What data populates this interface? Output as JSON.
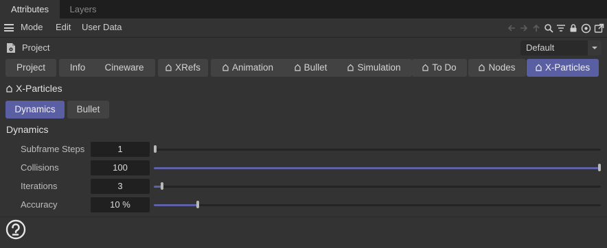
{
  "panel_tabs": {
    "attributes": "Attributes",
    "layers": "Layers"
  },
  "menu": {
    "mode": "Mode",
    "edit": "Edit",
    "user_data": "User Data"
  },
  "toolbar_icons": [
    "arrow-left-icon",
    "arrow-right-icon",
    "arrow-up-icon",
    "search-icon",
    "filter-icon",
    "lock-icon",
    "target-icon",
    "new-window-icon"
  ],
  "project": {
    "title": "Project",
    "preset": "Default"
  },
  "tabs": [
    {
      "label": "Project",
      "home_icon": false
    },
    {
      "label": "Info",
      "home_icon": false
    },
    {
      "label": "Cineware",
      "home_icon": false
    },
    {
      "label": "XRefs",
      "home_icon": true
    },
    {
      "label": "Animation",
      "home_icon": true
    },
    {
      "label": "Bullet",
      "home_icon": true
    },
    {
      "label": "Simulation",
      "home_icon": true
    },
    {
      "label": "To Do",
      "home_icon": true
    },
    {
      "label": "Nodes",
      "home_icon": true
    },
    {
      "label": "X-Particles",
      "home_icon": true,
      "active": true
    }
  ],
  "section": {
    "title": "X-Particles"
  },
  "sub_tabs": [
    {
      "label": "Dynamics",
      "active": true
    },
    {
      "label": "Bullet",
      "active": false
    }
  ],
  "group": {
    "title": "Dynamics"
  },
  "params": [
    {
      "label": "Subframe Steps",
      "value": "1",
      "slider_fraction": 0.0
    },
    {
      "label": "Collisions",
      "value": "100",
      "slider_fraction": 1.0
    },
    {
      "label": "Iterations",
      "value": "3",
      "slider_fraction": 0.018
    },
    {
      "label": "Accuracy",
      "value": "10 %",
      "slider_fraction": 0.098
    }
  ],
  "colors": {
    "accent": "#5a5fa3",
    "slider_fill": "#5e63a8",
    "background": "#333333",
    "tab_bar": "#1e1e1e"
  }
}
